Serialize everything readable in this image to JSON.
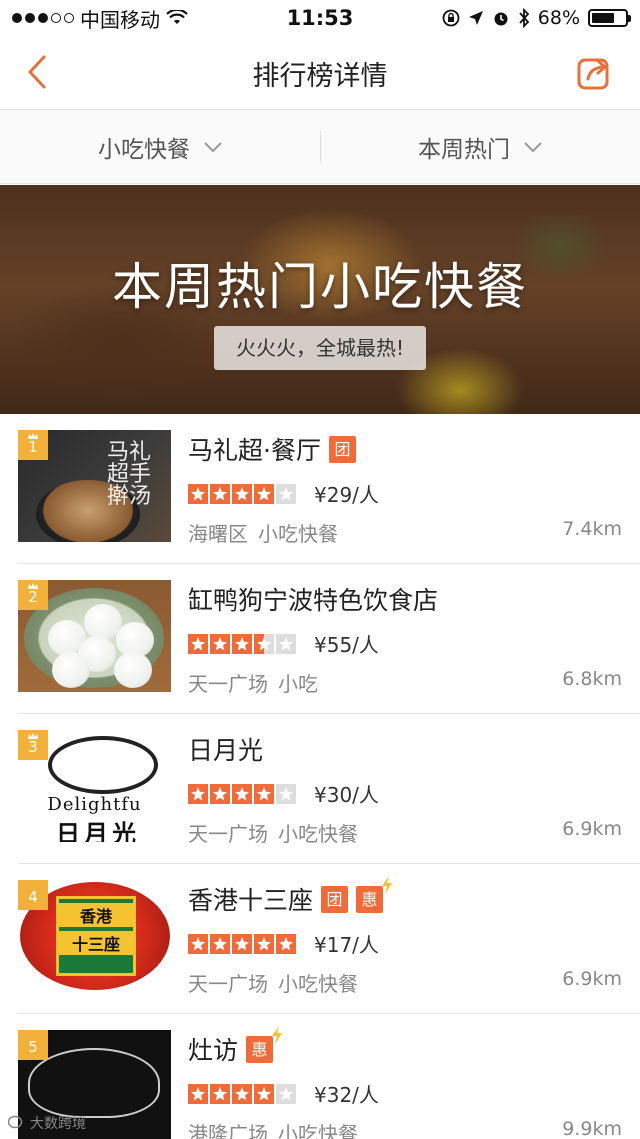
{
  "status_bar": {
    "carrier": "中国移动",
    "time": "11:53",
    "battery": "68%",
    "battery_level": 0.68
  },
  "nav": {
    "title": "排行榜详情"
  },
  "filters": {
    "category": "小吃快餐",
    "period": "本周热门"
  },
  "banner": {
    "title": "本周热门小吃快餐",
    "subtitle": "火火火，全城最热!"
  },
  "list": [
    {
      "rank": "1",
      "name": "马礼超·餐厅",
      "tags": [
        "团"
      ],
      "rating": 4,
      "price": "¥29/人",
      "area": "海曙区",
      "category": "小吃快餐",
      "distance": "7.4km"
    },
    {
      "rank": "2",
      "name": "缸鸭狗宁波特色饮食店",
      "tags": [],
      "rating": 3.5,
      "price": "¥55/人",
      "area": "天一广场",
      "category": "小吃",
      "distance": "6.8km"
    },
    {
      "rank": "3",
      "name": "日月光",
      "tags": [],
      "rating": 4,
      "price": "¥30/人",
      "area": "天一广场",
      "category": "小吃快餐",
      "distance": "6.9km"
    },
    {
      "rank": "4",
      "name": "香港十三座",
      "tags": [
        "团",
        "惠"
      ],
      "rating": 5,
      "price": "¥17/人",
      "area": "天一广场",
      "category": "小吃快餐",
      "distance": "6.9km"
    },
    {
      "rank": "5",
      "name": "灶访",
      "tags": [
        "惠"
      ],
      "rating": 4,
      "price": "¥32/人",
      "area": "港隆广场",
      "category": "小吃快餐",
      "distance": "9.9km"
    }
  ],
  "thumbs": {
    "t1_calligraphy": "马礼超手擀汤",
    "t3_logo_en": "Delightfu",
    "t3_logo_cn": "日月光",
    "t4_line1": "香港",
    "t4_line2": "十三座"
  },
  "watermark": "大数跨境",
  "colors": {
    "accent": "#f06a3a",
    "rank_badge": "#f2b13a"
  }
}
